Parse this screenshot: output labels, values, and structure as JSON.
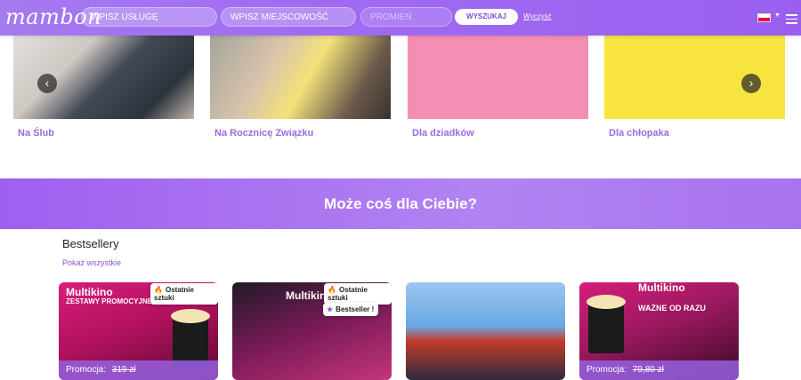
{
  "header": {
    "logo": "mambon",
    "service_placeholder": "WPISZ USŁUGĘ",
    "location_placeholder": "WPISZ MIEJSCOWOŚĆ",
    "radius_placeholder": "PROMIEŃ",
    "search_label": "WYSZUKAJ",
    "clear_label": "Wyczyść",
    "flag_colors": [
      "#ffffff",
      "#dc143c"
    ]
  },
  "carousel": {
    "prev_icon": "chevron-left-icon",
    "next_icon": "chevron-right-icon",
    "items": [
      {
        "title": "Na Ślub"
      },
      {
        "title": "Na Rocznicę Związku"
      },
      {
        "title": "Dla dziadków"
      },
      {
        "title": "Dla chłopaka"
      }
    ]
  },
  "banner": {
    "title": "Może coś dla Ciebie?"
  },
  "bestsellers": {
    "title": "Bestsellery",
    "show_all": "Pokaż wszystkie",
    "products": [
      {
        "brand": "Multikino",
        "line": "ZESTAWY PROMOCYJNE",
        "badges": [
          "Ostatnie sztuki"
        ],
        "promo_label": "Promocja:",
        "old_price": "319 zł"
      },
      {
        "brand": "Multikino",
        "badges": [
          "Ostatnie sztuki",
          "Bestseller !"
        ]
      },
      {},
      {
        "brand": "Multikino",
        "line": "WAŻNE OD RAZU",
        "promo_label": "Promocja:",
        "old_price": "79,80 zł"
      }
    ]
  },
  "colors": {
    "accent": "#9b6be0",
    "header": "#a06bf2"
  }
}
